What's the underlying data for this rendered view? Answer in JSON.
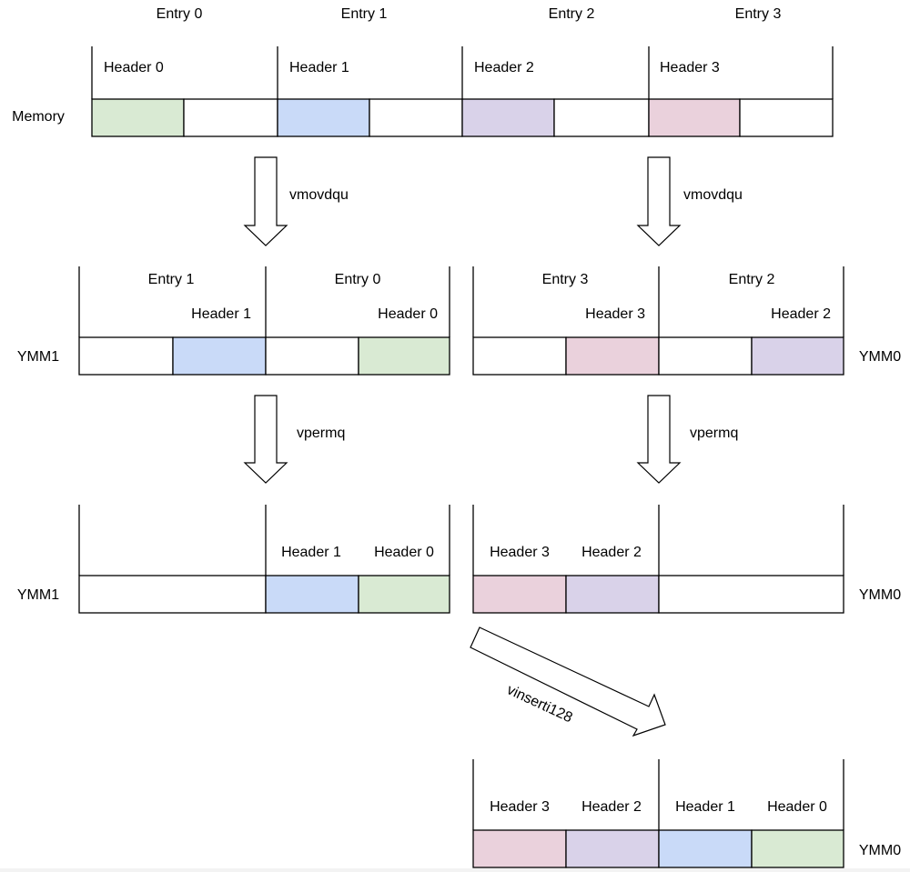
{
  "colors": {
    "header0": "#d9ead3",
    "header1": "#c9daf8",
    "header2": "#d9d2e9",
    "header3": "#ead1dc",
    "empty": "#ffffff",
    "stroke": "#000000"
  },
  "memory": {
    "label": "Memory",
    "entries": [
      {
        "entry_label": "Entry 0",
        "header_label": "Header 0",
        "color_key": "header0"
      },
      {
        "entry_label": "Entry 1",
        "header_label": "Header 1",
        "color_key": "header1"
      },
      {
        "entry_label": "Entry 2",
        "header_label": "Header 2",
        "color_key": "header2"
      },
      {
        "entry_label": "Entry 3",
        "header_label": "Header 3",
        "color_key": "header3"
      }
    ]
  },
  "step1": {
    "left_arrow_label": "vmovdqu",
    "right_arrow_label": "vmovdqu",
    "ymm1": {
      "label": "YMM1",
      "lanes": [
        {
          "entry_label": "Entry 1",
          "header_label": "Header 1",
          "color_key": "header1"
        },
        {
          "entry_label": "Entry 0",
          "header_label": "Header 0",
          "color_key": "header0"
        }
      ]
    },
    "ymm0": {
      "label": "YMM0",
      "lanes": [
        {
          "entry_label": "Entry 3",
          "header_label": "Header 3",
          "color_key": "header3"
        },
        {
          "entry_label": "Entry 2",
          "header_label": "Header 2",
          "color_key": "header2"
        }
      ]
    }
  },
  "step2": {
    "left_arrow_label": "vpermq",
    "right_arrow_label": "vpermq",
    "ymm1": {
      "label": "YMM1",
      "cells": [
        {
          "header_label": "",
          "color_key": "empty"
        },
        {
          "header_label": "",
          "color_key": "empty"
        },
        {
          "header_label": "Header 1",
          "color_key": "header1"
        },
        {
          "header_label": "Header 0",
          "color_key": "header0"
        }
      ]
    },
    "ymm0": {
      "label": "YMM0",
      "cells": [
        {
          "header_label": "Header 3",
          "color_key": "header3"
        },
        {
          "header_label": "Header 2",
          "color_key": "header2"
        },
        {
          "header_label": "",
          "color_key": "empty"
        },
        {
          "header_label": "",
          "color_key": "empty"
        }
      ]
    }
  },
  "step3": {
    "arrow_label": "vinserti128",
    "ymm0": {
      "label": "YMM0",
      "cells": [
        {
          "header_label": "Header 3",
          "color_key": "header3"
        },
        {
          "header_label": "Header 2",
          "color_key": "header2"
        },
        {
          "header_label": "Header 1",
          "color_key": "header1"
        },
        {
          "header_label": "Header 0",
          "color_key": "header0"
        }
      ]
    }
  }
}
